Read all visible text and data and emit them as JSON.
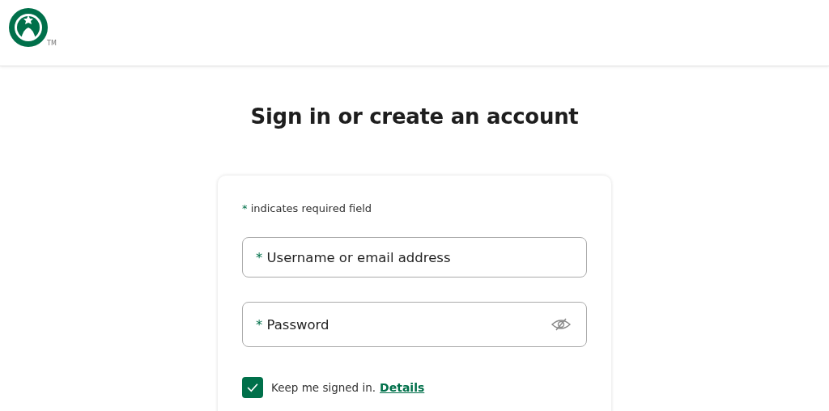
{
  "header": {
    "logo_mark": "TM"
  },
  "title": "Sign in or create an account",
  "form": {
    "required_note": {
      "mark": "*",
      "text": "indicates required field"
    },
    "fields": [
      {
        "kind": "text",
        "required": true,
        "mark": "*",
        "placeholder": "Username or email address"
      },
      {
        "kind": "password",
        "required": true,
        "mark": "*",
        "placeholder": "Password"
      }
    ],
    "keep_signed_in": {
      "checked": true,
      "label": "Keep me signed in.",
      "link": "Details"
    }
  }
}
